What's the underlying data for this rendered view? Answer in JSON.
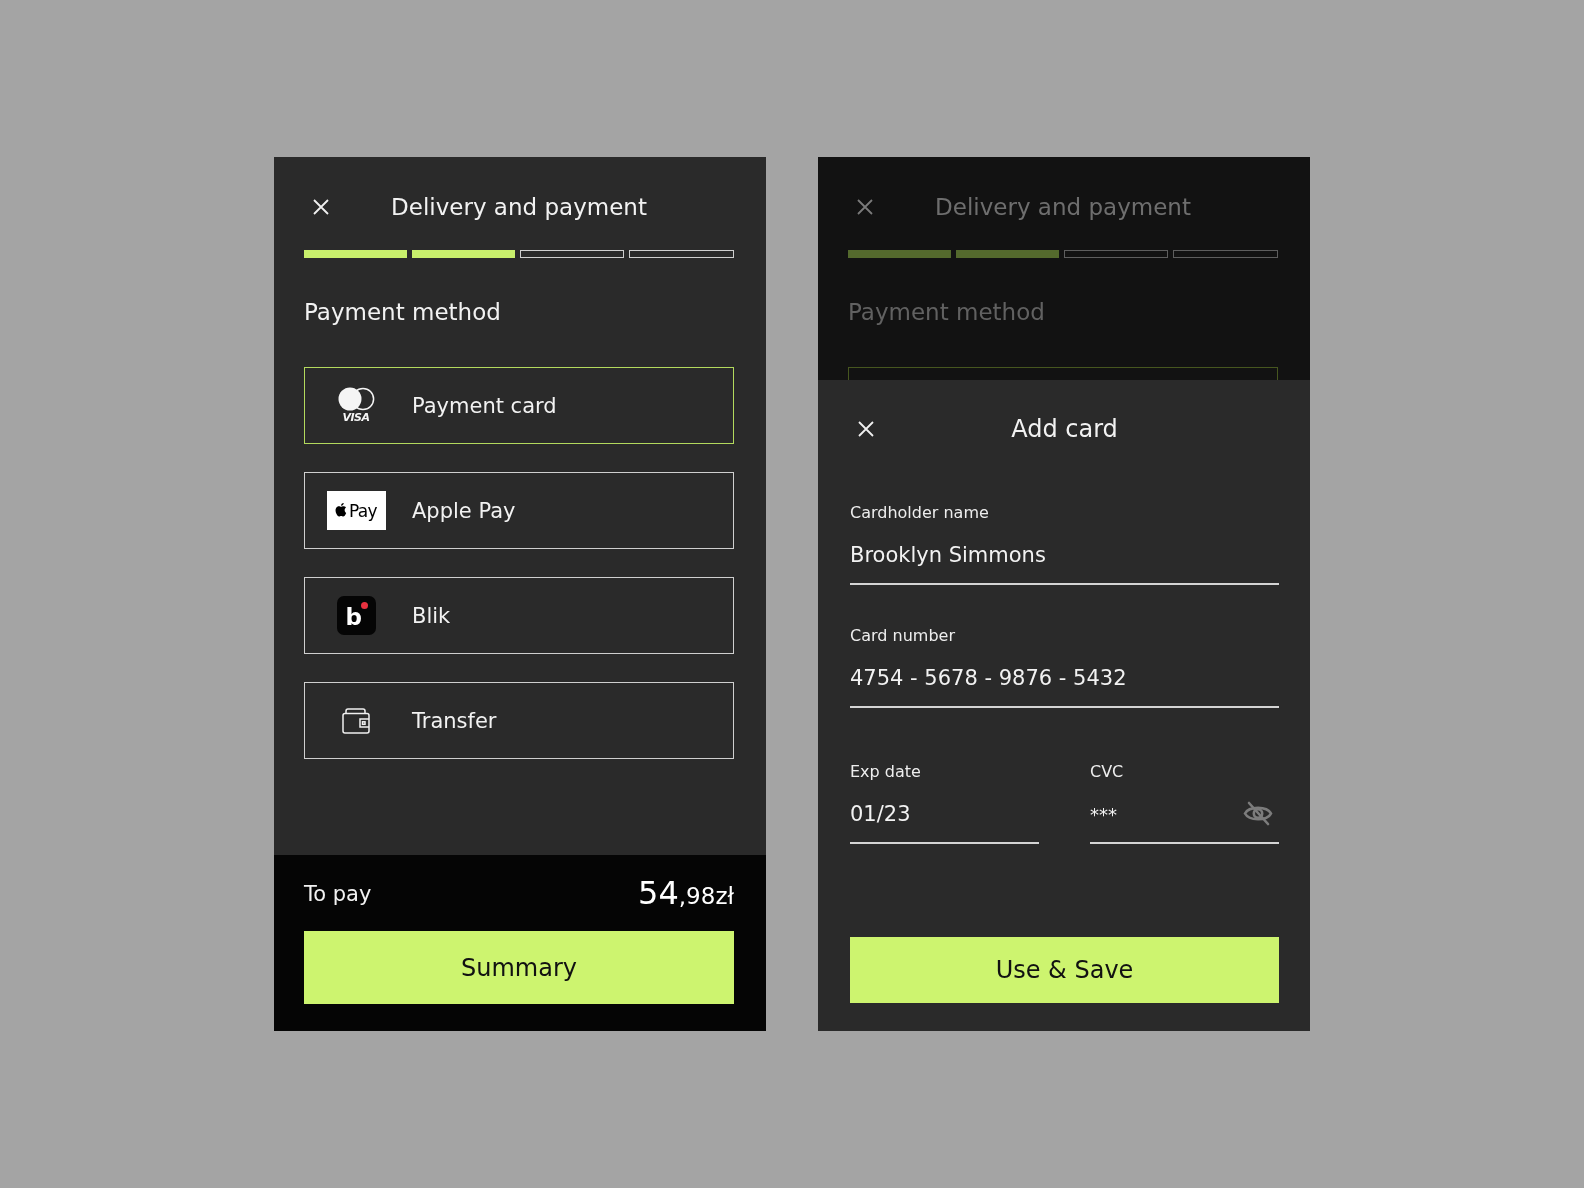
{
  "payment_screen": {
    "title": "Delivery and payment",
    "steps": [
      {
        "done": true
      },
      {
        "done": true
      },
      {
        "done": false
      },
      {
        "done": false
      }
    ],
    "section_title": "Payment method",
    "methods": [
      {
        "kind": "card",
        "label": "Payment card",
        "logo_text": "VISA",
        "selected": true
      },
      {
        "kind": "apple_pay",
        "label": "Apple Pay",
        "logo_text": "Pay",
        "selected": false
      },
      {
        "kind": "blik",
        "label": "Blik",
        "logo_text": "b",
        "selected": false
      },
      {
        "kind": "transfer",
        "label": "Transfer",
        "selected": false
      }
    ],
    "footer": {
      "total_label": "To pay",
      "total_whole": "54",
      "total_rest": ",98zł",
      "button": "Summary"
    }
  },
  "add_card_screen": {
    "background": {
      "title": "Delivery and payment",
      "steps": [
        {
          "done": true
        },
        {
          "done": true
        },
        {
          "done": false
        },
        {
          "done": false
        }
      ],
      "section_title": "Payment method"
    },
    "sheet": {
      "title": "Add card",
      "fields": [
        {
          "label": "Cardholder name",
          "value": "Brooklyn Simmons"
        },
        {
          "label": "Card number",
          "value": "4754 - 5678 - 9876 - 5432"
        }
      ],
      "short_fields": [
        {
          "kind": "text",
          "label": "Exp date",
          "value": "01/23"
        },
        {
          "kind": "secret",
          "label": "CVC",
          "value": "***"
        }
      ],
      "button": "Use & Save"
    }
  }
}
